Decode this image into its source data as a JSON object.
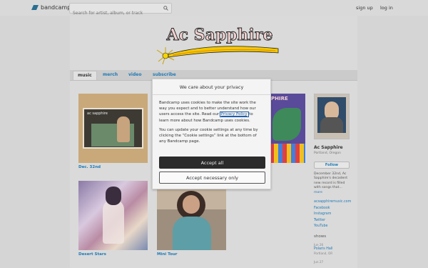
{
  "topbar": {
    "logo_text": "bandcamp",
    "search_placeholder": "Search for artist, album, or track",
    "signup_label": "sign up",
    "login_label": "log in"
  },
  "artist": {
    "banner_text": "Ac Sapphire",
    "name": "Ac Sapphire",
    "location": "Portland, Oregon",
    "follow_label": "Follow",
    "bio_text": "December 32nd, Ac Sapphire's decadent new record is filled with songs that...",
    "bio_more": "more",
    "links": [
      "acsapphiremusic.com",
      "Facebook",
      "Instagram",
      "Twitter",
      "YouTube"
    ],
    "shows_heading": "shows",
    "shows": [
      {
        "date": "Jun 26",
        "venue": "Polaris Hall",
        "city": "Portland, OR"
      },
      {
        "date": "Jun 27",
        "venue": "",
        "city": ""
      }
    ]
  },
  "tabs": [
    "music",
    "merch",
    "video",
    "subscribe"
  ],
  "albums": [
    {
      "title": "Dec. 32nd",
      "cover_text": "ac sapphire"
    },
    {
      "title": "Desert Stars"
    },
    {
      "title": "Mini Tour"
    },
    {
      "title": "",
      "cover_text": "PHIRE"
    }
  ],
  "dialog": {
    "title": "We care about your privacy",
    "para1_before": "Bandcamp uses cookies to make the site work the way you expect and to better understand how our users access the site. Read our ",
    "privacy_link": "Privacy Policy",
    "para1_after": " to learn more about how Bandcamp uses cookies.",
    "para2": "You can update your cookie settings at any time by clicking the “Cookie settings” link at the bottom of any Bandcamp page.",
    "accept_all": "Accept all",
    "accept_necessary": "Accept necessary only"
  },
  "colors": {
    "link": "#1f7ab5",
    "accept_button": "#2b2b2b",
    "logo": "#2a6f92"
  }
}
